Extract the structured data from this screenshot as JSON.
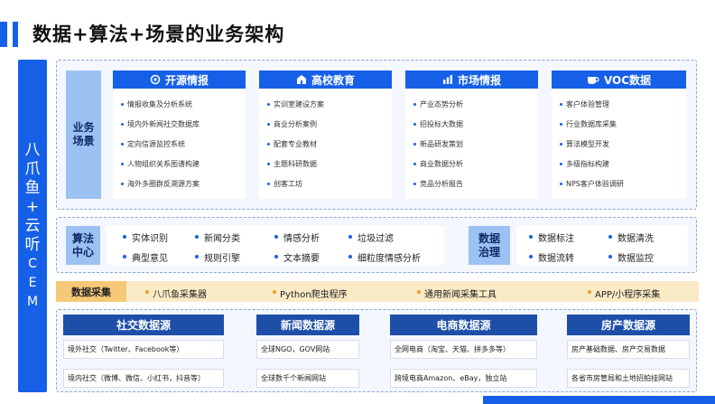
{
  "title": "数据+算法+场景的业务架构",
  "sidebar": {
    "chars": [
      "八",
      "爪",
      "鱼",
      "+",
      "云",
      "听",
      "C",
      "E",
      "M"
    ]
  },
  "scenes": {
    "label": "业务场景",
    "cards": [
      {
        "title": "开源情报",
        "icon": "open-source-icon",
        "items": [
          "情报收集及分析系统",
          "境内外新闻社交数据库",
          "定向信源监控系统",
          "人物组织关系图谱构建",
          "海外多圈群反溯源方案"
        ]
      },
      {
        "title": "高校教育",
        "icon": "school-icon",
        "items": [
          "实训室建设方案",
          "商业分析案例",
          "配套专业教材",
          "主题科研数据",
          "创客工坊"
        ]
      },
      {
        "title": "市场情报",
        "icon": "market-icon",
        "items": [
          "产业态势分析",
          "招投标大数据",
          "新品研发策划",
          "商业数据分析",
          "竞品分析报告"
        ]
      },
      {
        "title": "VOC数据",
        "icon": "coffee-cup-icon",
        "items": [
          "客户体验管理",
          "行业数据库采集",
          "算法模型开发",
          "多级指标构建",
          "NPS客户体验调研"
        ]
      }
    ]
  },
  "algorithm": {
    "label": "算法中心",
    "items": [
      "实体识别",
      "新闻分类",
      "情感分析",
      "垃圾过滤",
      "典型意见",
      "规则引擎",
      "文本摘要",
      "细粒度情感分析"
    ]
  },
  "governance": {
    "label": "数据治理",
    "items": [
      "数据标注",
      "数据清洗",
      "数据流转",
      "数据监控"
    ]
  },
  "collection": {
    "label": "数据采集",
    "items": [
      "八爪鱼采集器",
      "Python爬虫程序",
      "通用新闻采集工具",
      "APP/小程序采集"
    ]
  },
  "sources": [
    {
      "title": "社交数据源",
      "items": [
        "境外社交（Twitter、Facebook等）",
        "境内社交（微博、微信、小红书，抖音等）"
      ]
    },
    {
      "title": "新闻数据源",
      "items": [
        "全球NGO，GOV网站",
        "全球数千个新闻网站"
      ]
    },
    {
      "title": "电商数据源",
      "items": [
        "全网电商（淘宝、天猫、拼多多等）",
        "跨境电商Amazon、eBay，独立站"
      ]
    },
    {
      "title": "房产数据源",
      "items": [
        "房产基础数据、房产交易数据",
        "各省市房管局和土地招拍挂网站"
      ]
    }
  ],
  "colors": {
    "primary": "#1660e8",
    "navy": "#1d4fa8",
    "label_bg": "#9cc2f4",
    "collect_bg": "#fbeac6",
    "collect_label": "#f6c978"
  }
}
